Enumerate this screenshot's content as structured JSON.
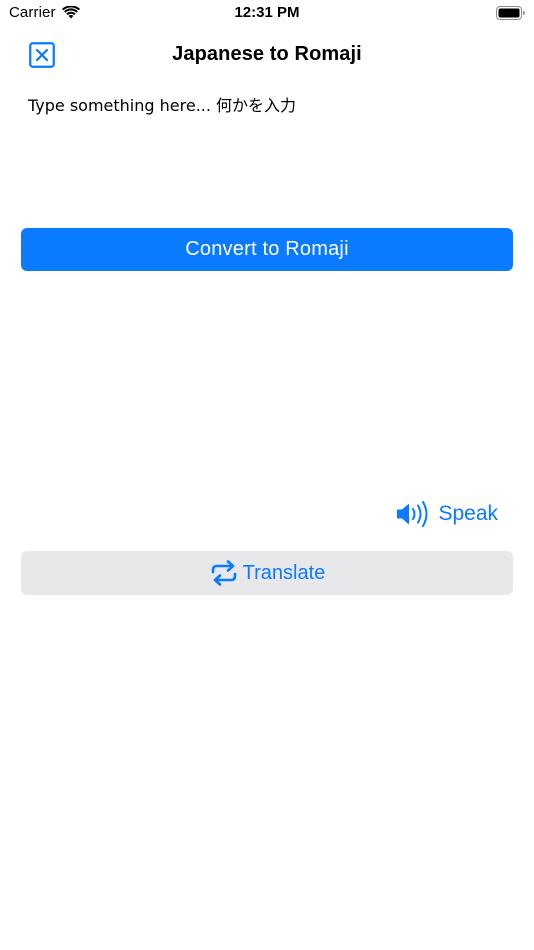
{
  "status_bar": {
    "carrier": "Carrier",
    "time": "12:31 PM",
    "wifi_icon": "wifi-icon",
    "battery_icon": "battery-full-icon"
  },
  "nav": {
    "title": "Japanese to Romaji",
    "close_icon": "close-square-icon"
  },
  "input": {
    "placeholder": "Type something here... 何かを入力",
    "value": ""
  },
  "convert_button": {
    "label": "Convert to Romaji"
  },
  "speak_button": {
    "label": "Speak",
    "icon": "speaker-wave-icon"
  },
  "translate_button": {
    "label": "Translate",
    "icon": "repeat-arrows-icon"
  },
  "colors": {
    "accent": "#0a7aff",
    "secondary_button_bg": "#e8e8ea",
    "background": "#ffffff"
  }
}
